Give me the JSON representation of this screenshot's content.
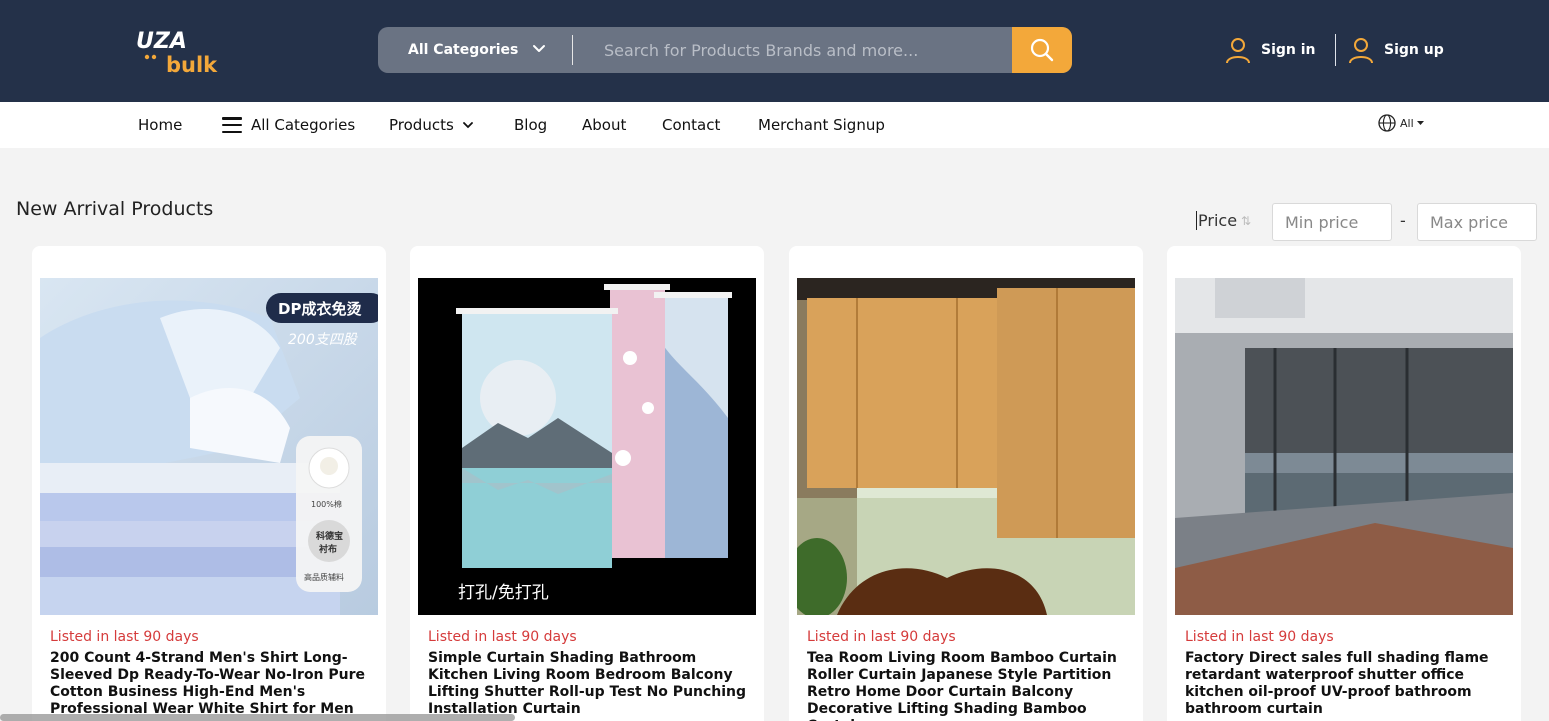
{
  "header": {
    "logo_text_top": "UZA",
    "logo_text_bottom": "bulk",
    "category_select": "All Categories",
    "search_placeholder": "Search for Products Brands and more...",
    "sign_in": "Sign in",
    "sign_up": "Sign up"
  },
  "nav": {
    "items": [
      "Home",
      "All Categories",
      "Products",
      "Blog",
      "About",
      "Contact",
      "Merchant Signup"
    ],
    "language": "All"
  },
  "section": {
    "title": "New Arrival Products",
    "price_label": "Price",
    "min_placeholder": "Min price",
    "max_placeholder": "Max price",
    "dash": "-"
  },
  "products": [
    {
      "listed": "Listed in last 90 days",
      "title": "200 Count 4-Strand Men's Shirt Long-Sleeved Dp Ready-To-Wear No-Iron Pure Cotton Business High-End Men's Professional Wear White Shirt for Men",
      "badge_1": "DP成衣免烫",
      "badge_2": "200支四股",
      "chip_1": "100%棉",
      "chip_2a": "科德宝",
      "chip_2b": "衬布",
      "chip_2c": "高品质辅料"
    },
    {
      "listed": "Listed in last 90 days",
      "title": "Simple Curtain Shading Bathroom Kitchen Living Room Bedroom Balcony Lifting Shutter Roll-up Test No Punching Installation Curtain",
      "caption": "打孔/免打孔"
    },
    {
      "listed": "Listed in last 90 days",
      "title": "Tea Room Living Room Bamboo Curtain Roller Curtain Japanese Style Partition Retro Home Door Curtain Balcony Decorative Lifting Shading Bamboo Curtain"
    },
    {
      "listed": "Listed in last 90 days",
      "title": "Factory Direct sales full shading flame retardant waterproof shutter office kitchen oil-proof UV-proof bathroom bathroom curtain"
    }
  ],
  "colors": {
    "header_bg": "#243149",
    "accent": "#f3a83a",
    "listed_red": "#d53b3b"
  }
}
